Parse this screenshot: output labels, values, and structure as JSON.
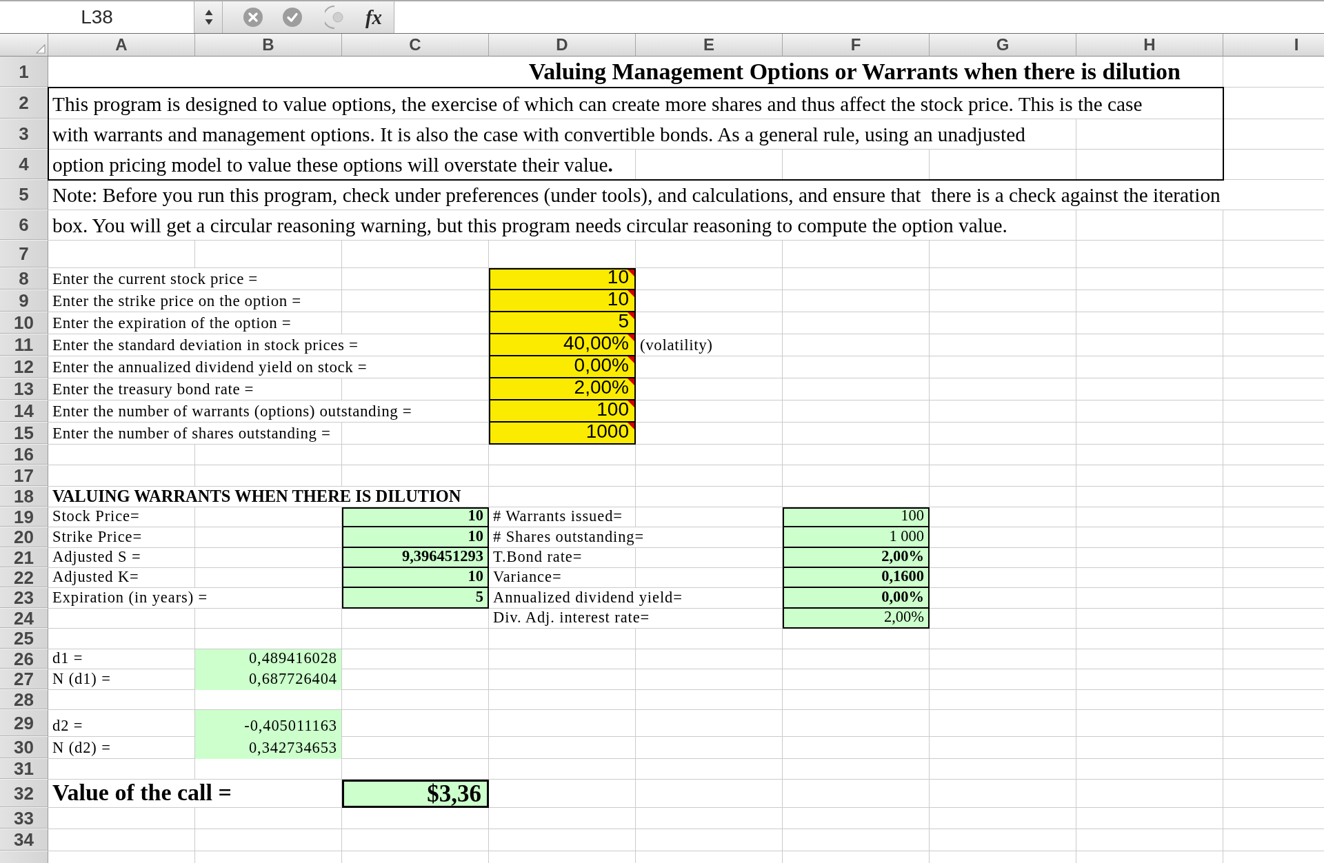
{
  "formula_bar": {
    "name_box": "L38",
    "function_label": "fx"
  },
  "column_headers": [
    "A",
    "B",
    "C",
    "D",
    "E",
    "F",
    "G",
    "H",
    "I"
  ],
  "row_headers": [
    "1",
    "2",
    "3",
    "4",
    "5",
    "6",
    "7",
    "8",
    "9",
    "10",
    "11",
    "12",
    "13",
    "14",
    "15",
    "16",
    "17",
    "18",
    "19",
    "20",
    "21",
    "22",
    "23",
    "24",
    "25",
    "26",
    "27",
    "28",
    "29",
    "30",
    "31",
    "32",
    "33",
    "34"
  ],
  "title": "Valuing Management Options or Warrants when there is dilution",
  "intro_lines": [
    "This program is designed to value options, the exercise of which can create more shares and thus affect the stock price. This is the case",
    "with warrants and management options. It is also the case with convertible bonds. As a general rule, using an unadjusted",
    "option pricing model to value these options will overstate their value**.**"
  ],
  "note_lines": [
    "Note: Before you run this program, check under preferences (under tools), and calculations, and ensure that  there is a check against the iteration",
    "box. You will get a circular reasoning warning, but this program needs circular reasoning to compute the option value."
  ],
  "inputs": [
    {
      "label": "Enter the current stock price =",
      "value": "10",
      "comment": true
    },
    {
      "label": "Enter the strike price on the option =",
      "value": "10",
      "comment": true
    },
    {
      "label": "Enter the expiration of the option =",
      "value": "5",
      "comment": true
    },
    {
      "label": "Enter the standard deviation in stock prices =",
      "value": "40,00%",
      "comment": true,
      "note": "(volatility)"
    },
    {
      "label": "Enter the annualized dividend yield on stock =",
      "value": "0,00%",
      "comment": true
    },
    {
      "label": "Enter the treasury bond rate =",
      "value": "2,00%",
      "comment": true
    },
    {
      "label": "Enter the number of warrants (options) outstanding =",
      "value": "100",
      "comment": true
    },
    {
      "label": "Enter the number of shares outstanding =",
      "value": "1000",
      "comment": true
    }
  ],
  "section_heading": "VALUING WARRANTS WHEN THERE IS DILUTION",
  "left_parameters": [
    {
      "label": "Stock Price=",
      "value": "10",
      "bold": true
    },
    {
      "label": "Strike Price=",
      "value": "10",
      "bold": true
    },
    {
      "label": "Adjusted S =",
      "value": "9,396451293",
      "bold": true
    },
    {
      "label": "Adjusted K=",
      "value": "10",
      "bold": true
    },
    {
      "label": "Expiration (in years) =",
      "value": "5",
      "bold": true
    }
  ],
  "right_parameters": [
    {
      "label": "# Warrants issued=",
      "value": "100",
      "bold": false
    },
    {
      "label": "# Shares outstanding=",
      "value": "1 000",
      "bold": false
    },
    {
      "label": "T.Bond rate=",
      "value": "2,00%",
      "bold": true
    },
    {
      "label": "Variance=",
      "value": "0,1600",
      "bold": true
    },
    {
      "label": "Annualized dividend yield=",
      "value": "0,00%",
      "bold": true
    },
    {
      "label": "Div. Adj. interest rate=",
      "value": "2,00%",
      "bold": false
    }
  ],
  "d_groups": [
    [
      {
        "label": "d1 =",
        "value": "0,489416028"
      },
      {
        "label": "N (d1) =",
        "value": "0,687726404"
      }
    ],
    [
      {
        "label": "d2 =",
        "value": "-0,405011163"
      },
      {
        "label": "N (d2) =",
        "value": "0,342734653"
      }
    ]
  ],
  "result": {
    "label": "Value of the call =",
    "value": "$3,36"
  }
}
